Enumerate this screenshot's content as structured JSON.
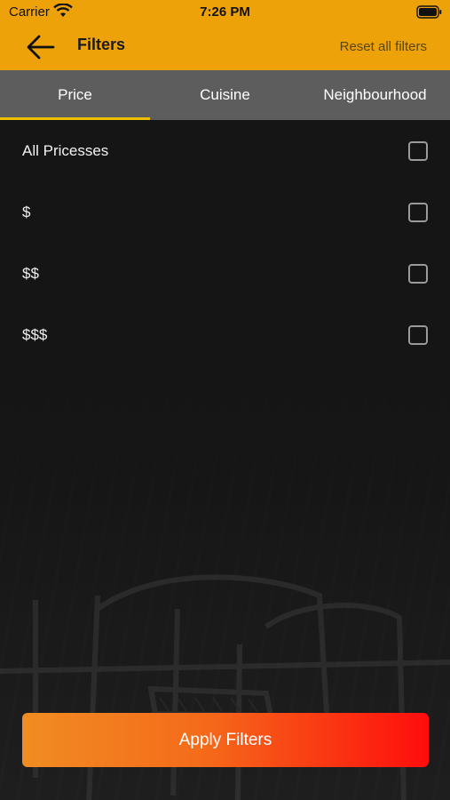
{
  "status_bar": {
    "carrier": "Carrier",
    "time": "7:26 PM"
  },
  "header": {
    "title": "Filters",
    "reset_label": "Reset all filters",
    "color": "#eea20a"
  },
  "tabs": [
    {
      "label": "Price",
      "active": true
    },
    {
      "label": "Cuisine",
      "active": false
    },
    {
      "label": "Neighbourhood",
      "active": false
    }
  ],
  "options": [
    {
      "label": "All Pricesses",
      "checked": false
    },
    {
      "label": "$",
      "checked": false
    },
    {
      "label": "$$",
      "checked": false
    },
    {
      "label": "$$$",
      "checked": false
    }
  ],
  "apply_button": {
    "label": "Apply Filters"
  },
  "icons": [
    "wifi-icon",
    "battery-icon",
    "back-arrow-icon"
  ]
}
